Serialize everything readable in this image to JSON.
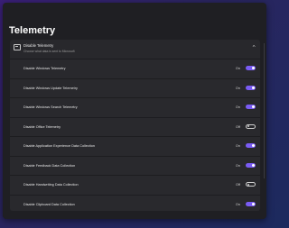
{
  "page_title": "Telemetry",
  "section": {
    "title": "Disable Telemetry",
    "subtitle": "Choose what data is sent to Microsoft",
    "icon": "settings-window-icon",
    "expanded": true
  },
  "items": [
    {
      "label": "Disable Windows Telemetry",
      "state": "On",
      "on": true
    },
    {
      "label": "Disable Windows Update Telemetry",
      "state": "On",
      "on": true
    },
    {
      "label": "Disable Windows Search Telemetry",
      "state": "On",
      "on": true
    },
    {
      "label": "Disable Office Telemetry",
      "state": "Off",
      "on": false
    },
    {
      "label": "Disable Application Experience Data Collection",
      "state": "On",
      "on": true
    },
    {
      "label": "Disable Feedback Data Collection",
      "state": "On",
      "on": true
    },
    {
      "label": "Disable Handwriting Data Collection",
      "state": "Off",
      "on": false
    },
    {
      "label": "Disable Clipboard Data Collection",
      "state": "On",
      "on": true
    }
  ],
  "colors": {
    "accent": "#7a5cf4",
    "background": "#1f1f23",
    "card": "#28282c"
  }
}
